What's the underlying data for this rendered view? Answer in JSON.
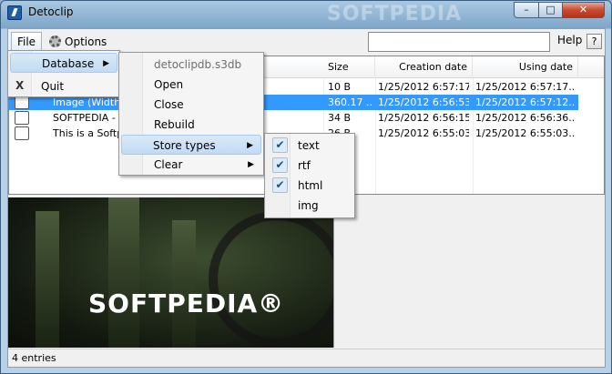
{
  "window": {
    "title": "Detoclip",
    "watermark": "SOFTPEDIA",
    "min": "–",
    "max": "□",
    "close": "✕"
  },
  "menubar": {
    "file": "File",
    "options": "Options",
    "help": "Help",
    "help_btn": "?"
  },
  "search": {
    "value": "",
    "placeholder": ""
  },
  "columns": {
    "size": "Size",
    "created": "Creation date",
    "using": "Using date"
  },
  "rows": [
    {
      "name": "",
      "size": "10 B",
      "created": "1/25/2012 6:57:17...",
      "using": "1/25/2012 6:57:17..."
    },
    {
      "name": "Image (Width=...ppRgb)",
      "size": "360.17 ...",
      "created": "1/25/2012 6:56:53...",
      "using": "1/25/2012 6:57:12..."
    },
    {
      "name": "SOFTPEDIA - L",
      "size": "34 B",
      "created": "1/25/2012 6:56:15...",
      "using": "1/25/2012 6:56:36..."
    },
    {
      "name": "This is a Softped",
      "size": "26 B",
      "created": "1/25/2012 6:55:03...",
      "using": "1/25/2012 6:55:03..."
    }
  ],
  "file_menu": {
    "database": "Database",
    "quit": "Quit"
  },
  "db_menu": {
    "filename": "detoclipdb.s3db",
    "open": "Open",
    "close": "Close",
    "rebuild": "Rebuild",
    "store_types": "Store types",
    "clear": "Clear"
  },
  "store_menu": [
    {
      "label": "text",
      "checked": true
    },
    {
      "label": "rtf",
      "checked": true
    },
    {
      "label": "html",
      "checked": true
    },
    {
      "label": "img",
      "checked": false
    }
  ],
  "preview": {
    "logo": "SOFTPEDIA®"
  },
  "status": {
    "text": "4 entries"
  },
  "colors": {
    "selection": "#3399ff",
    "menu_highlight": "#c1dbf5"
  }
}
